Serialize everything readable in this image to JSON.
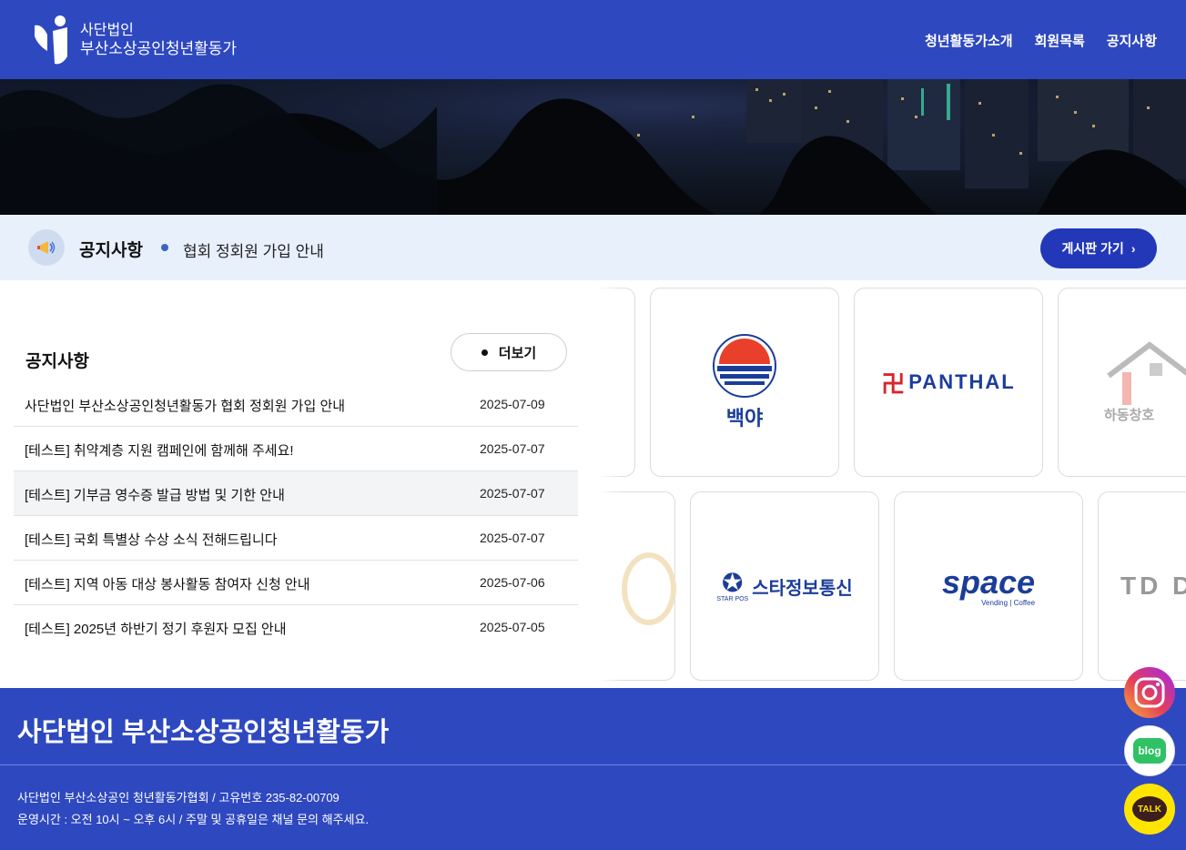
{
  "header": {
    "logo_line1": "사단법인",
    "logo_line2": "부산소상공인청년활동가",
    "nav": [
      "청년활동가소개",
      "회원목록",
      "공지사항"
    ]
  },
  "notice_bar": {
    "title": "공지사항",
    "latest": "협회 정회원 가입 안내",
    "button": "게시판 가기"
  },
  "notice_panel": {
    "title": "공지사항",
    "more": "더보기",
    "items": [
      {
        "title": "사단법인 부산소상공인청년활동가 협회 정회원 가입 안내",
        "date": "2025-07-09"
      },
      {
        "title": "[테스트] 취약계층 지원 캠페인에 함께해 주세요!",
        "date": "2025-07-07"
      },
      {
        "title": "[테스트] 기부금 영수증 발급 방법 및 기한 안내",
        "date": "2025-07-07"
      },
      {
        "title": "[테스트] 국회 특별상 수상 소식 전해드립니다",
        "date": "2025-07-07"
      },
      {
        "title": "[테스트] 지역 아동 대상 봉사활동 참여자 신청 안내",
        "date": "2025-07-06"
      },
      {
        "title": "[테스트] 2025년 하반기 정기 후원자 모집 안내",
        "date": "2025-07-05"
      }
    ]
  },
  "partners": {
    "baekya": "백야",
    "panthal": "PANTHAL",
    "hadong": "하동창호",
    "star": "스타정보통신",
    "star_sub": "STAR POS",
    "space": "space",
    "space_sub": "Vending | Coffee",
    "d_logo": "D"
  },
  "footer": {
    "title": "사단법인 부산소상공인청년활동가",
    "info1": "사단법인 부산소상공인 청년활동가협회 / 고유번호 235-82-00709",
    "info2": "운영시간 : 오전 10시 ~ 오후 6시 / 주말 및 공휴일은 채널 문의 해주세요."
  },
  "sns": {
    "blog": "blog",
    "talk": "TALK"
  },
  "colors": {
    "primary": "#2e48c0",
    "button": "#2338b8",
    "notice_bg": "#e8f0fc"
  }
}
